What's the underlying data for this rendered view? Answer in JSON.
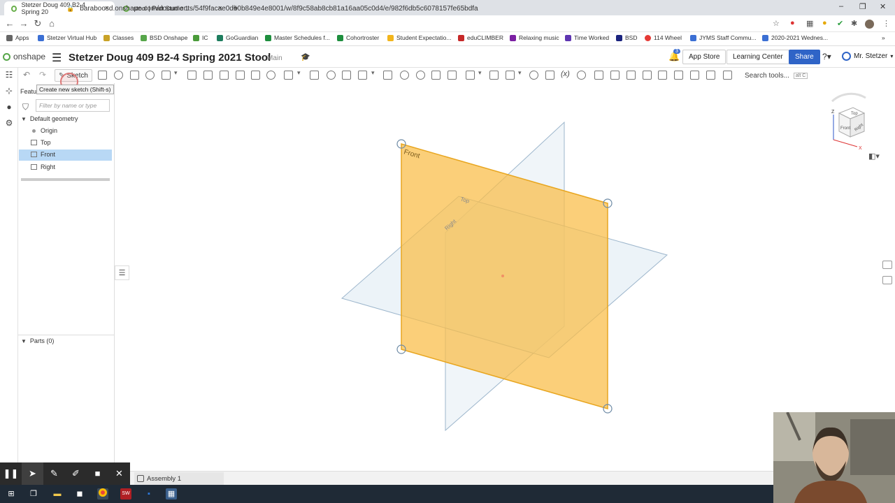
{
  "browser": {
    "tabs": [
      {
        "title": "Stetzer Doug 409 B2-4 Spring 20",
        "active": true
      },
      {
        "title": "stool | Part Studio 1",
        "active": false
      }
    ],
    "new_tab": "+",
    "url": "baraboosd.onshape.com/documents/54f9facae0db0b849e4e8001/w/8f9c58ab8cb81a16aa05c0d4/e/982f6db5c6078157fe65bdfa",
    "bookmarks": [
      "Apps",
      "Stetzer Virtual Hub",
      "Classes",
      "BSD Onshape",
      "IC",
      "GoGuardian",
      "Master Schedules f...",
      "Cohortroster",
      "Student Expectatio...",
      "eduCLIMBER",
      "Relaxing music",
      "Time Worked",
      "BSD",
      "114 Wheel",
      "JYMS Staff Commu...",
      "2020-2021 Wednes..."
    ],
    "bookmarks_more": "»"
  },
  "header": {
    "logo": "onshape",
    "document_title": "Stetzer Doug 409 B2-4 Spring 2021 Stool",
    "branch": "Main",
    "notification_count": "3",
    "app_store": "App Store",
    "learning_center": "Learning Center",
    "share": "Share",
    "help": "?",
    "user": "Mr. Stetzer"
  },
  "toolbar": {
    "sketch_label": "Sketch",
    "tooltip": "Create new sketch (Shift-s)",
    "search_tools": "Search tools...",
    "search_shortcut": "alt C"
  },
  "feature_panel": {
    "title": "Featu",
    "filter_placeholder": "Filter by name or type",
    "default_geometry": "Default geometry",
    "items": [
      "Origin",
      "Top",
      "Front",
      "Right"
    ],
    "selected": "Front",
    "parts": "Parts (0)"
  },
  "viewport": {
    "plane_labels": [
      "Front",
      "Top",
      "Right"
    ],
    "front_plane_color": "#f9bd45",
    "plane_color": "#dde9f3",
    "viewcube_faces": [
      "Top",
      "Front",
      "Right"
    ],
    "viewcube_axes": [
      "Z",
      "X"
    ]
  },
  "bottom": {
    "assembly_tab": "Assembly 1"
  }
}
